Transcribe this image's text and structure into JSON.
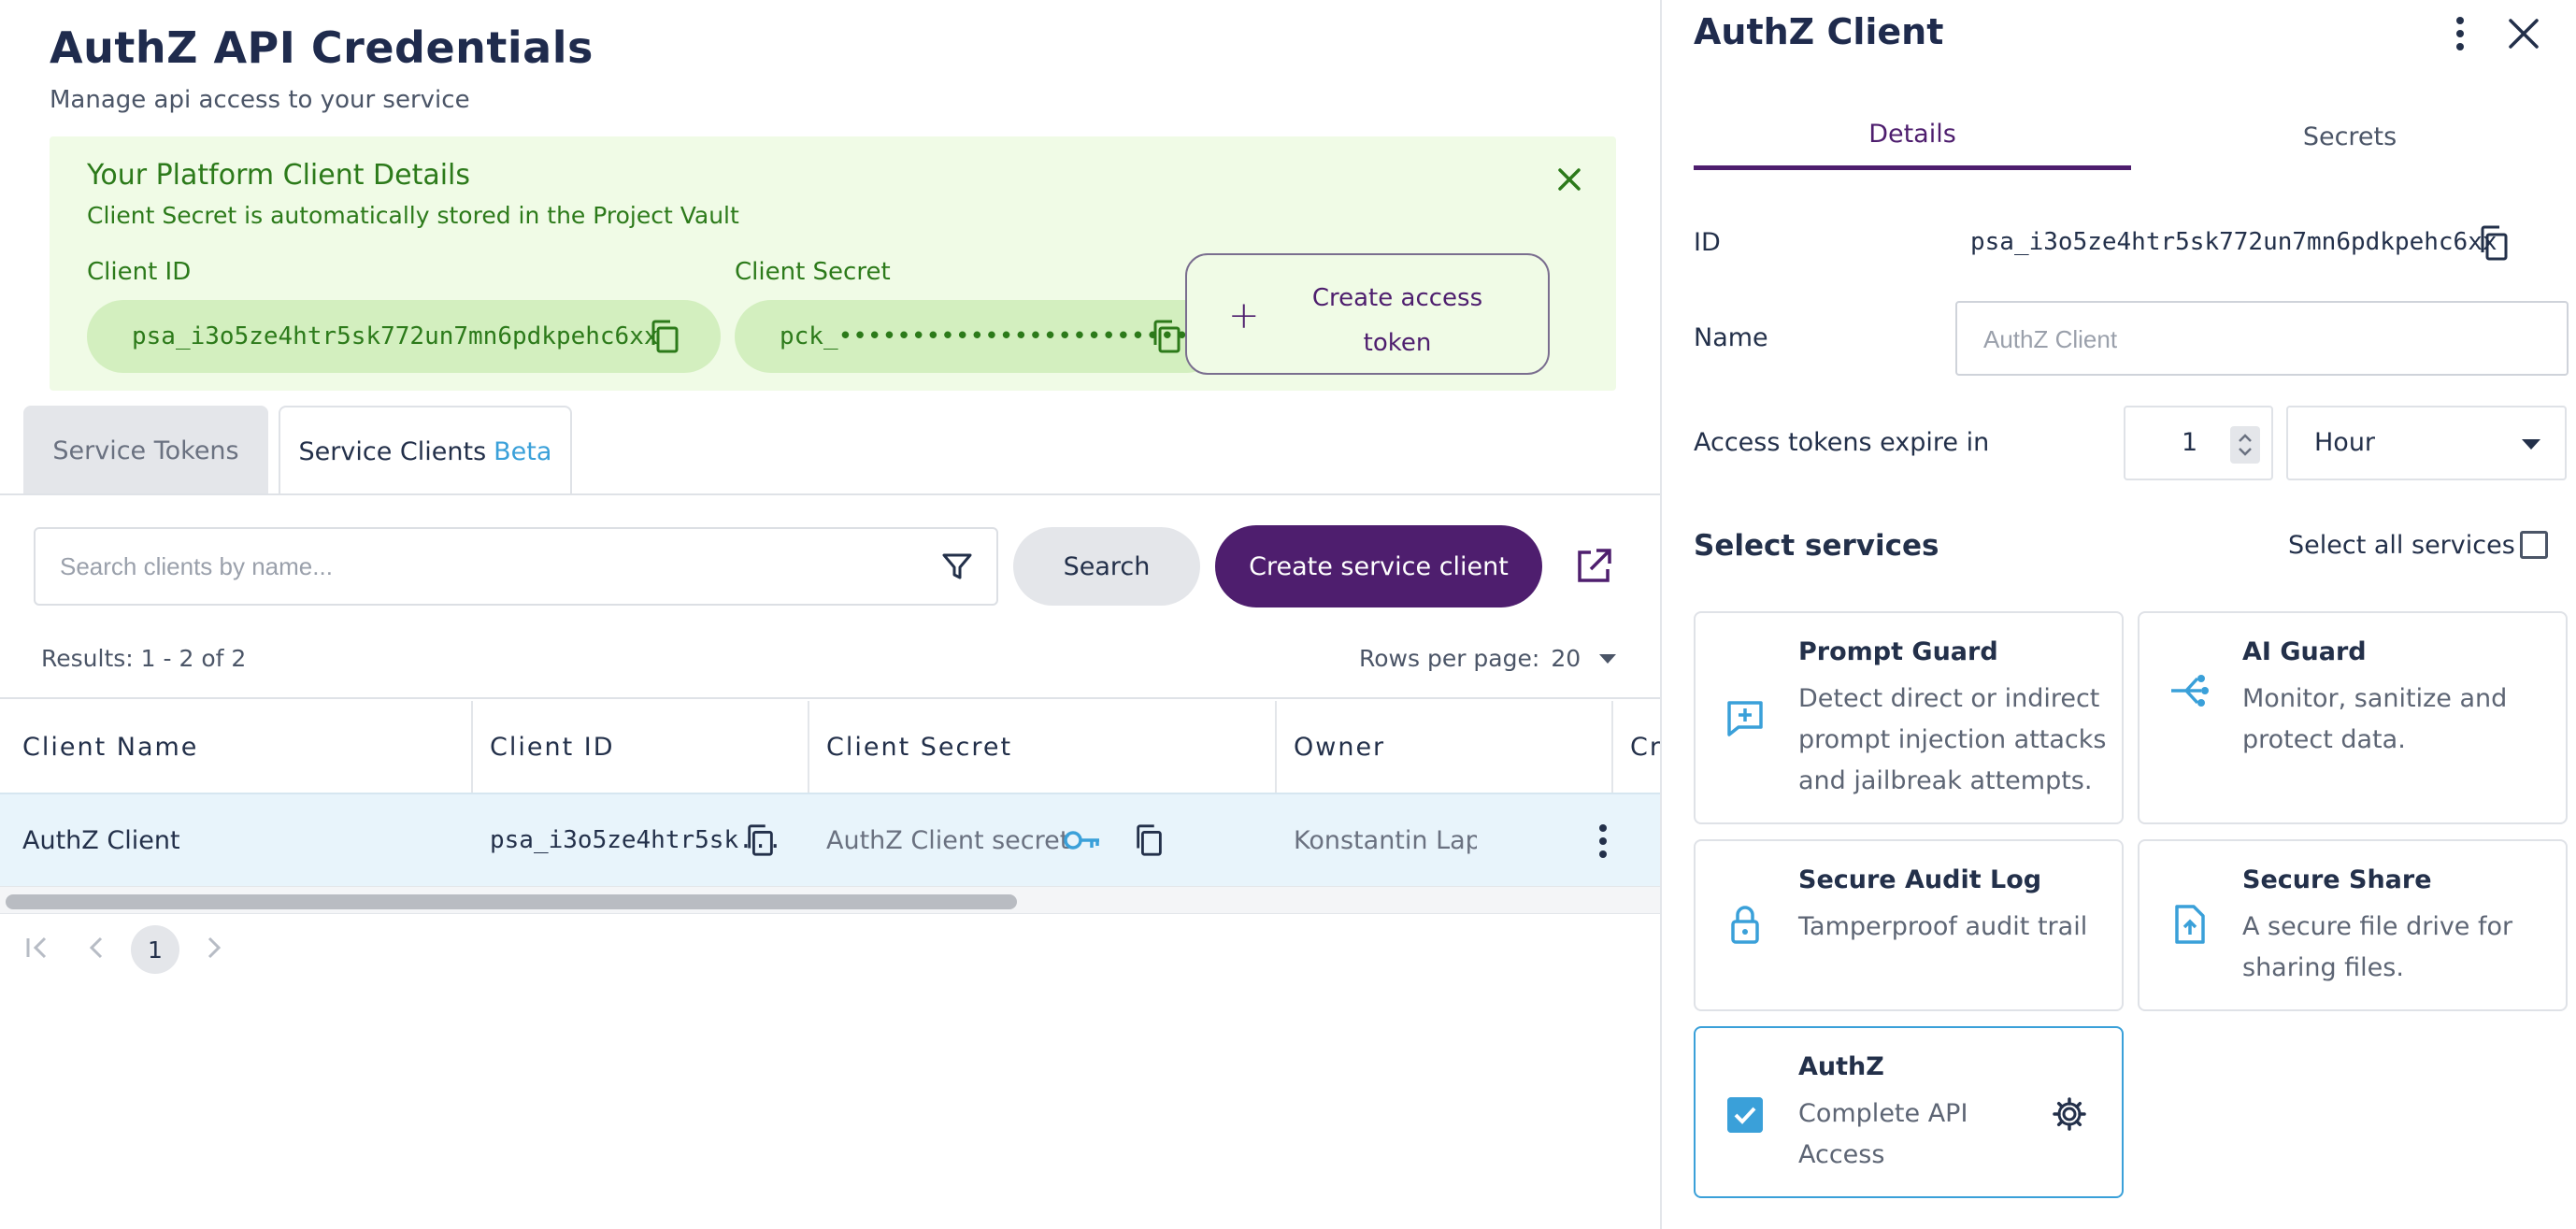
{
  "page": {
    "title": "AuthZ API Credentials",
    "subtitle": "Manage api access to your service"
  },
  "banner": {
    "title": "Your Platform Client Details",
    "subtitle": "Client Secret is automatically stored in the Project Vault",
    "client_id_label": "Client ID",
    "client_id_value": "psa_i3o5ze4htr5sk772un7mn6pdkpehc6xx",
    "client_secret_label": "Client Secret",
    "client_secret_value": "pck_••••••••••••••••••••••••••••e3oj",
    "create_token_label": "Create access token",
    "accent_color": "#2c7a1a",
    "background_color": "#f0fbe6"
  },
  "tabs": [
    {
      "label": "Service Tokens",
      "active": false
    },
    {
      "label": "Service Clients",
      "badge": "Beta",
      "active": true
    }
  ],
  "toolbar": {
    "search_placeholder": "Search clients by name...",
    "search_label": "Search",
    "create_label": "Create service client"
  },
  "results": {
    "summary": "Results: 1 - 2 of 2",
    "rows_label": "Rows per page:",
    "rows_value": "20"
  },
  "table": {
    "columns": [
      "Client Name",
      "Client ID",
      "Client Secret",
      "Owner",
      "Cr"
    ],
    "rows": [
      {
        "name": "AuthZ Client",
        "client_id": "psa_i3o5ze4htr5sk...",
        "secret": "AuthZ Client secret",
        "owner": "Konstantin Lap"
      }
    ]
  },
  "pagination": {
    "current_page": "1",
    "first_icon": "first-page-icon",
    "prev_icon": "chevron-left-icon",
    "next_icon": "chevron-right-icon"
  },
  "drawer": {
    "title": "AuthZ Client",
    "tabs": [
      {
        "label": "Details",
        "active": true
      },
      {
        "label": "Secrets",
        "active": false
      }
    ],
    "id_label": "ID",
    "id_value": "psa_i3o5ze4htr5sk772un7mn6pdkpehc6xx",
    "name_label": "Name",
    "name_placeholder": "AuthZ Client",
    "expire_label": "Access tokens expire in",
    "expire_value": "1",
    "expire_unit": "Hour",
    "services_heading": "Select services",
    "select_all_label": "Select all services",
    "services": [
      {
        "title": "Prompt Guard",
        "desc": "Detect direct or indirect prompt injection attacks and jailbreak attempts.",
        "icon": "prompt-guard-icon",
        "selected": false
      },
      {
        "title": "AI Guard",
        "desc": "Monitor, sanitize and protect data.",
        "icon": "ai-guard-icon",
        "selected": false
      },
      {
        "title": "Secure Audit Log",
        "desc": "Tamperproof audit trail",
        "icon": "lock-icon",
        "selected": false
      },
      {
        "title": "Secure Share",
        "desc": "A secure file drive for sharing files.",
        "icon": "file-upload-icon",
        "selected": false
      },
      {
        "title": "AuthZ",
        "desc": "Complete API Access",
        "icon": "checkbox-checked-icon",
        "selected": true
      }
    ]
  },
  "colors": {
    "primary": "#4e1e6e",
    "accent_blue": "#3aa0d9",
    "text": "#23304a",
    "row_highlight": "#e8f4fb"
  }
}
